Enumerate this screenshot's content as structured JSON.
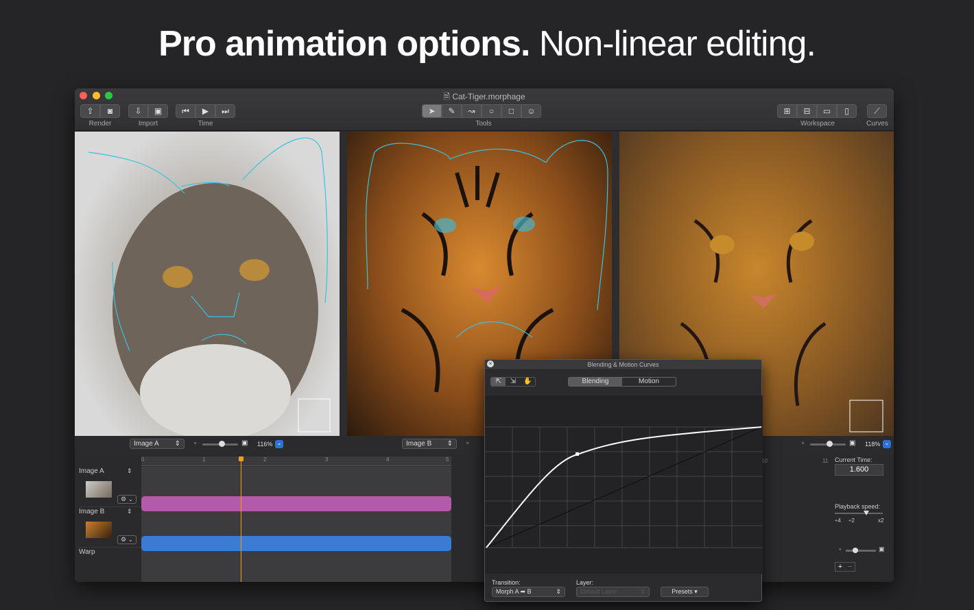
{
  "headline": {
    "bold": "Pro animation options.",
    "light": "Non-linear editing."
  },
  "window": {
    "title": "Cat-Tiger.morphage"
  },
  "toolbar": {
    "render": "Render",
    "import": "Import",
    "time": "Time",
    "tools": "Tools",
    "workspace": "Workspace",
    "curves": "Curves"
  },
  "panes": {
    "a": {
      "select": "Image A",
      "zoom": "116%"
    },
    "b": {
      "select": "Image B"
    },
    "c": {
      "zoom": "118%"
    }
  },
  "timeline": {
    "ruler": [
      "0",
      "1",
      "2",
      "3",
      "4",
      "5"
    ],
    "ruler_far": [
      "10",
      "11"
    ],
    "tracks": [
      {
        "label": "Image A"
      },
      {
        "label": "Image B"
      },
      {
        "label": "Warp"
      }
    ],
    "colors": {
      "bar_a": "#b35aaa",
      "bar_b": "#3b7bd4",
      "playhead": "#f0a020"
    }
  },
  "right_panel": {
    "current_time_label": "Current Time:",
    "current_time": "1.600",
    "playback_label": "Playback speed:",
    "speeds": [
      "÷4",
      "÷2",
      "x2"
    ],
    "plus": "+",
    "minus": "−"
  },
  "curves": {
    "title": "Blending & Motion Curves",
    "tabs": [
      "Blending",
      "Motion"
    ],
    "transition_label": "Transition:",
    "transition_value": "Morph A ➡ B",
    "layer_label": "Layer:",
    "layer_value": "Default Layer",
    "presets": "Presets"
  }
}
